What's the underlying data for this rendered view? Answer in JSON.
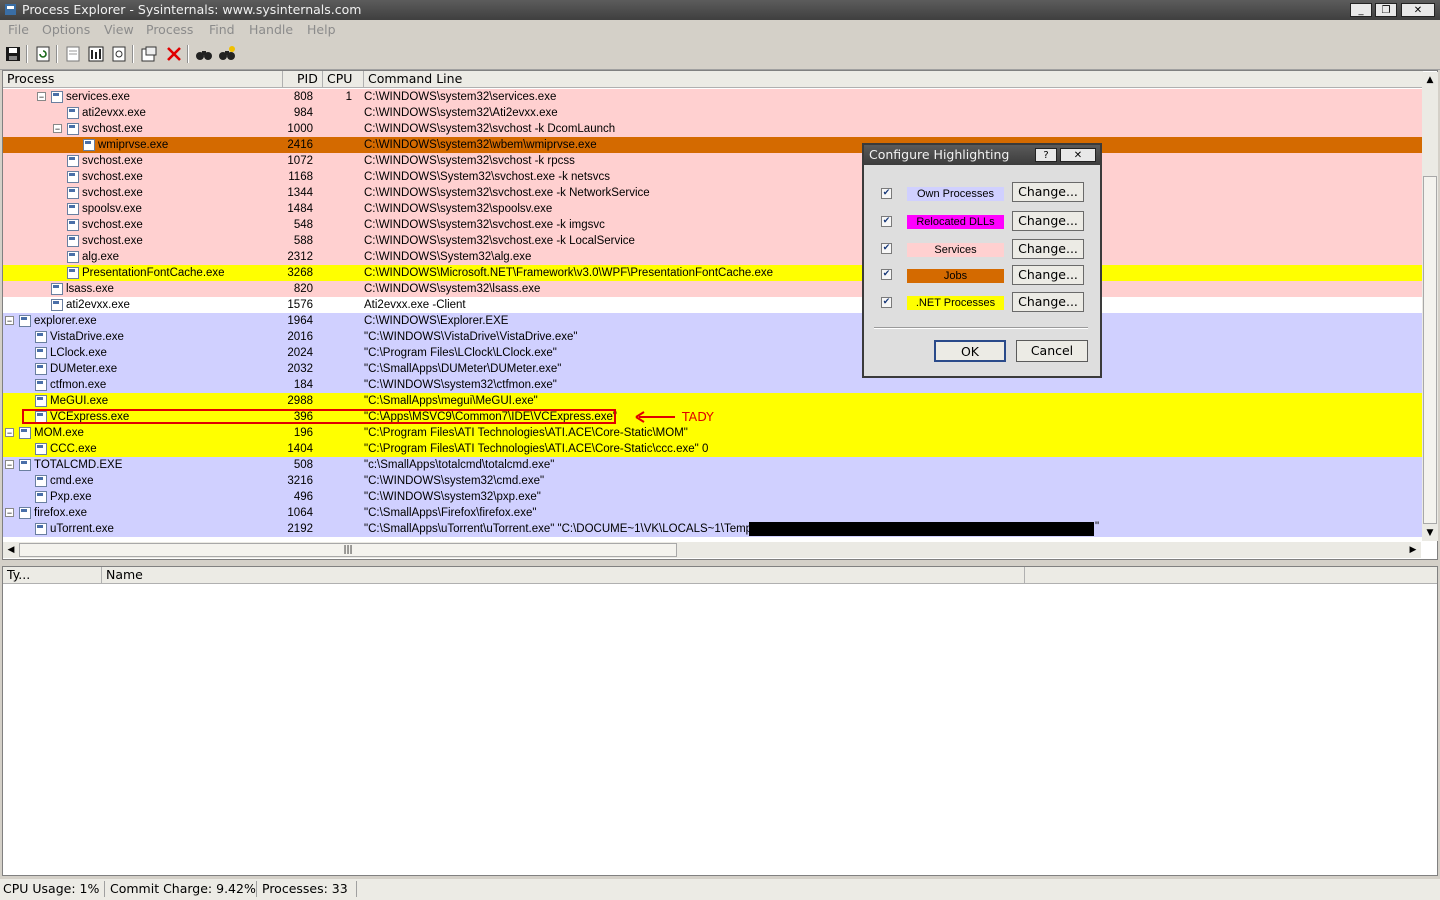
{
  "window": {
    "title": "Process Explorer - Sysinternals: www.sysinternals.com"
  },
  "menu": [
    "File",
    "Options",
    "View",
    "Process",
    "Find",
    "Handle",
    "Help"
  ],
  "tree": {
    "headers": {
      "process": "Process",
      "pid": "PID",
      "cpu": "CPU",
      "cmd": "Command Line"
    },
    "rows": [
      {
        "name": "services.exe",
        "pid": "808",
        "cpu": "1",
        "cmd": "C:\\WINDOWS\\system32\\services.exe",
        "bg": "#ffd0d0",
        "expander": "−"
      },
      {
        "name": "ati2evxx.exe",
        "pid": "984",
        "cpu": "",
        "cmd": "C:\\WINDOWS\\system32\\Ati2evxx.exe",
        "bg": "#ffd0d0",
        "expander": ""
      },
      {
        "name": "svchost.exe",
        "pid": "1000",
        "cpu": "",
        "cmd": "C:\\WINDOWS\\system32\\svchost -k DcomLaunch",
        "bg": "#ffd0d0",
        "expander": "−"
      },
      {
        "name": "wmiprvse.exe",
        "pid": "2416",
        "cpu": "",
        "cmd": "C:\\WINDOWS\\system32\\wbem\\wmiprvse.exe",
        "bg": "#d46a00",
        "expander": ""
      },
      {
        "name": "svchost.exe",
        "pid": "1072",
        "cpu": "",
        "cmd": "C:\\WINDOWS\\system32\\svchost -k rpcss",
        "bg": "#ffd0d0",
        "expander": ""
      },
      {
        "name": "svchost.exe",
        "pid": "1168",
        "cpu": "",
        "cmd": "C:\\WINDOWS\\System32\\svchost.exe -k netsvcs",
        "bg": "#ffd0d0",
        "expander": ""
      },
      {
        "name": "svchost.exe",
        "pid": "1344",
        "cpu": "",
        "cmd": "C:\\WINDOWS\\system32\\svchost.exe -k NetworkService",
        "bg": "#ffd0d0",
        "expander": ""
      },
      {
        "name": "spoolsv.exe",
        "pid": "1484",
        "cpu": "",
        "cmd": "C:\\WINDOWS\\system32\\spoolsv.exe",
        "bg": "#ffd0d0",
        "expander": ""
      },
      {
        "name": "svchost.exe",
        "pid": "548",
        "cpu": "",
        "cmd": "C:\\WINDOWS\\system32\\svchost.exe -k imgsvc",
        "bg": "#ffd0d0",
        "expander": ""
      },
      {
        "name": "svchost.exe",
        "pid": "588",
        "cpu": "",
        "cmd": "C:\\WINDOWS\\system32\\svchost.exe -k LocalService",
        "bg": "#ffd0d0",
        "expander": ""
      },
      {
        "name": "alg.exe",
        "pid": "2312",
        "cpu": "",
        "cmd": "C:\\WINDOWS\\System32\\alg.exe",
        "bg": "#ffd0d0",
        "expander": ""
      },
      {
        "name": "PresentationFontCache.exe",
        "pid": "3268",
        "cpu": "",
        "cmd": "C:\\WINDOWS\\Microsoft.NET\\Framework\\v3.0\\WPF\\PresentationFontCache.exe",
        "bg": "#ffff00",
        "expander": ""
      },
      {
        "name": "lsass.exe",
        "pid": "820",
        "cpu": "",
        "cmd": "C:\\WINDOWS\\system32\\lsass.exe",
        "bg": "#ffd0d0",
        "expander": ""
      },
      {
        "name": "ati2evxx.exe",
        "pid": "1576",
        "cpu": "",
        "cmd": "Ati2evxx.exe -Client",
        "bg": "#ffffff",
        "expander": ""
      },
      {
        "name": "explorer.exe",
        "pid": "1964",
        "cpu": "",
        "cmd": "C:\\WINDOWS\\Explorer.EXE",
        "bg": "#d0d0ff",
        "expander": "−"
      },
      {
        "name": "VistaDrive.exe",
        "pid": "2016",
        "cpu": "",
        "cmd": "\"C:\\WINDOWS\\VistaDrive\\VistaDrive.exe\"",
        "bg": "#d0d0ff",
        "expander": ""
      },
      {
        "name": "LClock.exe",
        "pid": "2024",
        "cpu": "",
        "cmd": "\"C:\\Program Files\\LClock\\LClock.exe\"",
        "bg": "#d0d0ff",
        "expander": ""
      },
      {
        "name": "DUMeter.exe",
        "pid": "2032",
        "cpu": "",
        "cmd": "\"C:\\SmallApps\\DUMeter\\DUMeter.exe\"",
        "bg": "#d0d0ff",
        "expander": ""
      },
      {
        "name": "ctfmon.exe",
        "pid": "184",
        "cpu": "",
        "cmd": "\"C:\\WINDOWS\\system32\\ctfmon.exe\"",
        "bg": "#d0d0ff",
        "expander": ""
      },
      {
        "name": "MeGUI.exe",
        "pid": "2988",
        "cpu": "",
        "cmd": "\"C:\\SmallApps\\megui\\MeGUI.exe\"",
        "bg": "#ffff00",
        "expander": ""
      },
      {
        "name": "VCExpress.exe",
        "pid": "396",
        "cpu": "",
        "cmd": "\"C:\\Apps\\MSVC9\\Common7\\IDE\\VCExpress.exe\"",
        "bg": "#ffff00",
        "expander": ""
      },
      {
        "name": "MOM.exe",
        "pid": "196",
        "cpu": "",
        "cmd": "\"C:\\Program Files\\ATI Technologies\\ATI.ACE\\Core-Static\\MOM\"",
        "bg": "#ffff00",
        "expander": "−"
      },
      {
        "name": "CCC.exe",
        "pid": "1404",
        "cpu": "",
        "cmd": "\"C:\\Program Files\\ATI Technologies\\ATI.ACE\\Core-Static\\ccc.exe\" 0",
        "bg": "#ffff00",
        "expander": ""
      },
      {
        "name": "TOTALCMD.EXE",
        "pid": "508",
        "cpu": "",
        "cmd": "\"c:\\SmallApps\\totalcmd\\totalcmd.exe\"",
        "bg": "#d0d0ff",
        "expander": "−"
      },
      {
        "name": "cmd.exe",
        "pid": "3216",
        "cpu": "",
        "cmd": "\"C:\\WINDOWS\\system32\\cmd.exe\"",
        "bg": "#d0d0ff",
        "expander": ""
      },
      {
        "name": "Pxp.exe",
        "pid": "496",
        "cpu": "",
        "cmd": "\"C:\\WINDOWS\\system32\\pxp.exe\"",
        "bg": "#d0d0ff",
        "expander": ""
      },
      {
        "name": "firefox.exe",
        "pid": "1064",
        "cpu": "",
        "cmd": "\"C:\\SmallApps\\Firefox\\firefox.exe\"",
        "bg": "#d0d0ff",
        "expander": "−"
      },
      {
        "name": "uTorrent.exe",
        "pid": "2192",
        "cpu": "",
        "cmd": "\"C:\\SmallApps\\uTorrent\\uTorrent.exe\"  \"C:\\DOCUME~1\\VK\\LOCALS~1\\Temp\\",
        "bg": "#d0d0ff",
        "expander": ""
      }
    ],
    "annotation": "TADY"
  },
  "lower": {
    "headers": {
      "type": "Ty...",
      "name": "Name"
    }
  },
  "status": {
    "cpu": "CPU Usage: 1%",
    "commit": "Commit Charge: 9.42%",
    "processes": "Processes: 33"
  },
  "dialog": {
    "title": "Configure Highlighting",
    "help": "?",
    "items": [
      {
        "label": "Own Processes",
        "color": "#d0d0ff",
        "change": "Change..."
      },
      {
        "label": "Relocated DLLs",
        "color": "#ff00ff",
        "change": "Change..."
      },
      {
        "label": "Services",
        "color": "#ffd0d0",
        "change": "Change..."
      },
      {
        "label": "Jobs",
        "color": "#d46a00",
        "change": "Change..."
      },
      {
        "label": ".NET Processes",
        "color": "#ffff00",
        "change": "Change..."
      }
    ],
    "ok": "OK",
    "cancel": "Cancel"
  }
}
